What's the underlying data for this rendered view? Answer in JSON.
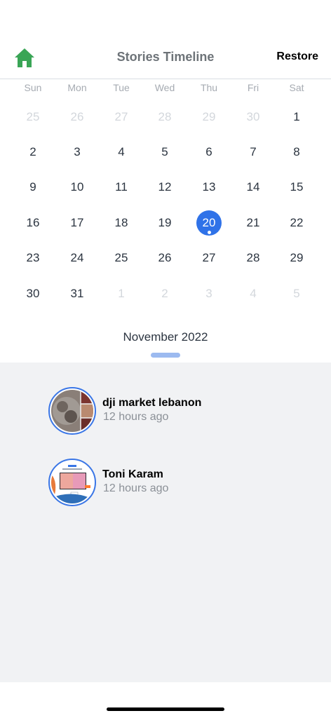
{
  "header": {
    "title": "Stories Timeline",
    "restore_label": "Restore",
    "home_icon": "home-icon",
    "home_icon_color": "#3aa556"
  },
  "calendar": {
    "weekdays": [
      "Sun",
      "Mon",
      "Tue",
      "Wed",
      "Thu",
      "Fri",
      "Sat"
    ],
    "weeks": [
      [
        {
          "d": "25",
          "m": true
        },
        {
          "d": "26",
          "m": true
        },
        {
          "d": "27",
          "m": true
        },
        {
          "d": "28",
          "m": true
        },
        {
          "d": "29",
          "m": true
        },
        {
          "d": "30",
          "m": true
        },
        {
          "d": "1"
        }
      ],
      [
        {
          "d": "2"
        },
        {
          "d": "3"
        },
        {
          "d": "4"
        },
        {
          "d": "5"
        },
        {
          "d": "6"
        },
        {
          "d": "7"
        },
        {
          "d": "8"
        }
      ],
      [
        {
          "d": "9"
        },
        {
          "d": "10"
        },
        {
          "d": "11"
        },
        {
          "d": "12"
        },
        {
          "d": "13"
        },
        {
          "d": "14"
        },
        {
          "d": "15"
        }
      ],
      [
        {
          "d": "16"
        },
        {
          "d": "17"
        },
        {
          "d": "18"
        },
        {
          "d": "19"
        },
        {
          "d": "20",
          "selected": true,
          "has_stories": true
        },
        {
          "d": "21"
        },
        {
          "d": "22"
        }
      ],
      [
        {
          "d": "23"
        },
        {
          "d": "24"
        },
        {
          "d": "25"
        },
        {
          "d": "26"
        },
        {
          "d": "27"
        },
        {
          "d": "28"
        },
        {
          "d": "29"
        }
      ],
      [
        {
          "d": "30"
        },
        {
          "d": "31"
        },
        {
          "d": "1",
          "m": true
        },
        {
          "d": "2",
          "m": true
        },
        {
          "d": "3",
          "m": true
        },
        {
          "d": "4",
          "m": true
        },
        {
          "d": "5",
          "m": true
        }
      ]
    ],
    "month_label": "November 2022",
    "selected_color": "#2f72e8"
  },
  "stories": [
    {
      "name": "dji market lebanon",
      "time": "12 hours ago",
      "avatar": "photo-collage-avatar"
    },
    {
      "name": "Toni Karam",
      "time": "12 hours ago",
      "avatar": "tv-product-avatar"
    }
  ]
}
